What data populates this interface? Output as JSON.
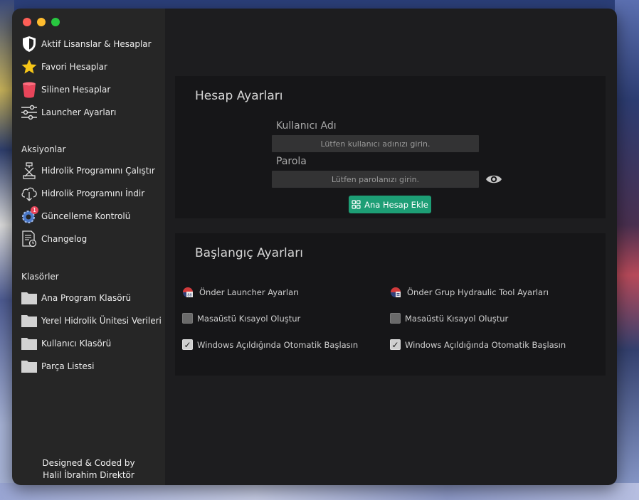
{
  "sidebar": {
    "items": [
      {
        "label": "Aktif Lisanslar & Hesaplar",
        "icon": "shield-icon"
      },
      {
        "label": "Favori Hesaplar",
        "icon": "star-icon"
      },
      {
        "label": "Silinen Hesaplar",
        "icon": "trash-bin-icon"
      },
      {
        "label": "Launcher Ayarları",
        "icon": "sliders-icon"
      }
    ],
    "actions_title": "Aksiyonlar",
    "actions": [
      {
        "label": "Hidrolik Programını Çalıştır",
        "icon": "hydraulic-run-icon"
      },
      {
        "label": "Hidrolik Programını İndir",
        "icon": "cloud-download-icon"
      },
      {
        "label": "Güncelleme Kontrolü",
        "icon": "update-gear-icon",
        "badge": "1"
      },
      {
        "label": "Changelog",
        "icon": "changelog-document-icon"
      }
    ],
    "folders_title": "Klasörler",
    "folders": [
      {
        "label": "Ana Program Klasörü",
        "icon": "folder-icon"
      },
      {
        "label": "Yerel Hidrolik Ünitesi Verileri",
        "icon": "folder-icon"
      },
      {
        "label": "Kullanıcı Klasörü",
        "icon": "folder-icon"
      },
      {
        "label": "Parça Listesi",
        "icon": "folder-icon"
      }
    ],
    "credits_line1": "Designed & Coded by",
    "credits_line2": "Halil İbrahim Direktör"
  },
  "account": {
    "title": "Hesap Ayarları",
    "username_label": "Kullanıcı Adı",
    "username_placeholder": "Lütfen kullanıcı adınızı girin.",
    "password_label": "Parola",
    "password_placeholder": "Lütfen parolanızı girin.",
    "add_button": "Ana Hesap Ekle"
  },
  "startup": {
    "title": "Başlangıç Ayarları",
    "columns": [
      {
        "app_label": "Önder Launcher Ayarları",
        "shortcut_label": "Masaüstü Kısayol Oluştur",
        "shortcut_checked": false,
        "autostart_label": "Windows Açıldığında Otomatik Başlasın",
        "autostart_checked": true
      },
      {
        "app_label": "Önder Grup Hydraulic Tool Ayarları",
        "shortcut_label": "Masaüstü Kısayol Oluştur",
        "shortcut_checked": false,
        "autostart_label": "Windows Açıldığında Otomatik Başlasın",
        "autostart_checked": true
      }
    ]
  },
  "colors": {
    "accent_green": "#1d9e75",
    "sidebar_bg": "#262626",
    "main_bg": "#1d1d1f",
    "panel_bg": "#161618",
    "star": "#f5c518",
    "trash": "#e8455a"
  }
}
